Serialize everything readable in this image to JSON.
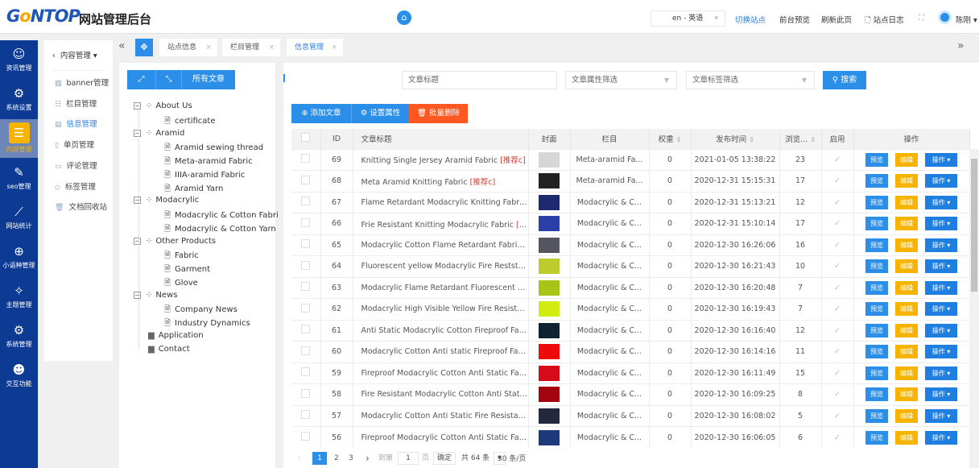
{
  "header": {
    "logo": "Gontop",
    "title": "网站管理后台",
    "lang": "en - 英语",
    "switch_site": "切换站点",
    "preview": "前台预览",
    "refresh": "刷新此页",
    "site_log": "站点日志",
    "user": "陈刚"
  },
  "nav": [
    {
      "label": "资讯管理",
      "icon": "chat-icon"
    },
    {
      "label": "系统设置",
      "icon": "gear-icon"
    },
    {
      "label": "内容管理",
      "icon": "document-icon",
      "active": true
    },
    {
      "label": "seo管理",
      "icon": "seo-icon"
    },
    {
      "label": "网站统计",
      "icon": "chart-icon"
    },
    {
      "label": "小语种管理",
      "icon": "globe-icon"
    },
    {
      "label": "主题管理",
      "icon": "theme-icon"
    },
    {
      "label": "系统管理",
      "icon": "cogs-icon"
    },
    {
      "label": "交互功能",
      "icon": "users-icon"
    }
  ],
  "submenu": {
    "title": "内容管理",
    "items": [
      "banner管理",
      "栏目管理",
      "信息管理",
      "单页管理",
      "评论管理",
      "标签管理",
      "文档回收站"
    ],
    "active": "信息管理"
  },
  "tabs": [
    "站点信息",
    "栏目管理",
    "信息管理"
  ],
  "tree": {
    "all_label": "所有文章",
    "nodes": [
      {
        "label": "About Us",
        "children": [
          "certificate"
        ]
      },
      {
        "label": "Aramid",
        "children": [
          "Aramid sewing thread",
          "Meta-aramid Fabric",
          "IIIA-aramid Fabric",
          "Aramid Yarn"
        ]
      },
      {
        "label": "Modacrylic",
        "children": [
          "Modacrylic & Cotton Fabri",
          "Modacrylic & Cotton Yarn"
        ]
      },
      {
        "label": "Other Products",
        "children": [
          "Fabric",
          "Garment",
          "Glove"
        ]
      },
      {
        "label": "News",
        "children": [
          "Company News",
          "Industry Dynamics"
        ]
      },
      {
        "label": "Application",
        "children": []
      },
      {
        "label": "Contact",
        "children": []
      }
    ]
  },
  "filters": {
    "title_placeholder": "文章标题",
    "attr_placeholder": "文章属性筛选",
    "tag_placeholder": "文章标签筛选",
    "search": "搜索"
  },
  "actions": {
    "add": "添加文章",
    "set_attr": "设置属性",
    "batch_delete": "批量删除"
  },
  "table": {
    "headers": [
      "ID",
      "文章标题",
      "封面",
      "栏目",
      "权重",
      "发布时间",
      "浏览...",
      "启用",
      "操作"
    ],
    "btn_preview": "预览",
    "btn_edit": "编辑",
    "btn_ops": "操作",
    "rows": [
      {
        "id": "69",
        "title": "Knitting Single Jersey Aramid Fabric",
        "tag": "[推荐c]",
        "cover": "#d6d6d6",
        "category": "Meta-aramid Fa...",
        "weight": "0",
        "date": "2021-01-05 13:38:22",
        "views": "23"
      },
      {
        "id": "68",
        "title": "Meta Aramid Knitting Fabric",
        "tag": "[推荐c]",
        "cover": "#222222",
        "category": "Meta-aramid Fa...",
        "weight": "0",
        "date": "2020-12-31 15:15:31",
        "views": "17"
      },
      {
        "id": "67",
        "title": "Flame Retardant Modacrylic Knitting Fabric...",
        "tag": "",
        "cover": "#1e2a6e",
        "category": "Modacrylic & C...",
        "weight": "0",
        "date": "2020-12-31 15:13:21",
        "views": "12"
      },
      {
        "id": "66",
        "title": "Frie Resistant Knitting Modacrylic Fabric",
        "tag": "[推...",
        "cover": "#2a3fa8",
        "category": "Modacrylic & C...",
        "weight": "0",
        "date": "2020-12-31 15:10:14",
        "views": "17"
      },
      {
        "id": "65",
        "title": "Modacrylic Cotton Flame Retardant Fabric",
        "tag": "[...",
        "cover": "#555560",
        "category": "Modacrylic & C...",
        "weight": "0",
        "date": "2020-12-30 16:26:06",
        "views": "16"
      },
      {
        "id": "64",
        "title": "Fluorescent yellow Modacrylic Fire Reststan...",
        "tag": "",
        "cover": "#bccc2c",
        "category": "Modacrylic & C...",
        "weight": "0",
        "date": "2020-12-30 16:21:43",
        "views": "10"
      },
      {
        "id": "63",
        "title": "Modacrylic Flame Retardant Fluorescent yell...",
        "tag": "",
        "cover": "#a8c419",
        "category": "Modacrylic & C...",
        "weight": "0",
        "date": "2020-12-30 16:20:48",
        "views": "7"
      },
      {
        "id": "62",
        "title": "Modacrylic High Visible Yellow Fire Resistan...",
        "tag": "",
        "cover": "#d2ec12",
        "category": "Modacrylic & C...",
        "weight": "0",
        "date": "2020-12-30 16:19:43",
        "views": "7"
      },
      {
        "id": "61",
        "title": "Anti Static Modacrylic Cotton Fireproof Fabr...",
        "tag": "",
        "cover": "#0e2433",
        "category": "Modacrylic & C...",
        "weight": "0",
        "date": "2020-12-30 16:16:40",
        "views": "12"
      },
      {
        "id": "60",
        "title": "Modacrylic Cotton Anti static Fireproof Fabr...",
        "tag": "",
        "cover": "#ee0a0a",
        "category": "Modacrylic & C...",
        "weight": "0",
        "date": "2020-12-30 16:14:16",
        "views": "11"
      },
      {
        "id": "59",
        "title": "Fireproof Modacrylic Cotton Anti Static Fabr...",
        "tag": "",
        "cover": "#d50b1a",
        "category": "Modacrylic & C...",
        "weight": "0",
        "date": "2020-12-30 16:11:49",
        "views": "15"
      },
      {
        "id": "58",
        "title": "Fire Resistant Modacrylic Cotton Anti Static ...",
        "tag": "",
        "cover": "#a2050f",
        "category": "Modacrylic & C...",
        "weight": "0",
        "date": "2020-12-30 16:09:25",
        "views": "8"
      },
      {
        "id": "57",
        "title": "Modacrylic Cotton Anti Static Fire Resistant ...",
        "tag": "",
        "cover": "#23283f",
        "category": "Modacrylic & C...",
        "weight": "0",
        "date": "2020-12-30 16:08:02",
        "views": "5"
      },
      {
        "id": "56",
        "title": "Fireproof Modacrylic Cotton Anti Static Fabr...",
        "tag": "",
        "cover": "#1f3a7a",
        "category": "Modacrylic & C...",
        "weight": "0",
        "date": "2020-12-30 16:06:05",
        "views": "6"
      }
    ]
  },
  "pagination": {
    "pages": [
      "1",
      "2",
      "3"
    ],
    "current": "1",
    "goto_label": "到第",
    "goto_value": "1",
    "page_unit": "页",
    "confirm": "确定",
    "total": "共 64 条",
    "per_page": "30 条/页"
  },
  "colors": {
    "primary": "#2b8ee8",
    "nav": "#0d3a93",
    "warning": "#f6b400",
    "danger": "#ff5722"
  }
}
